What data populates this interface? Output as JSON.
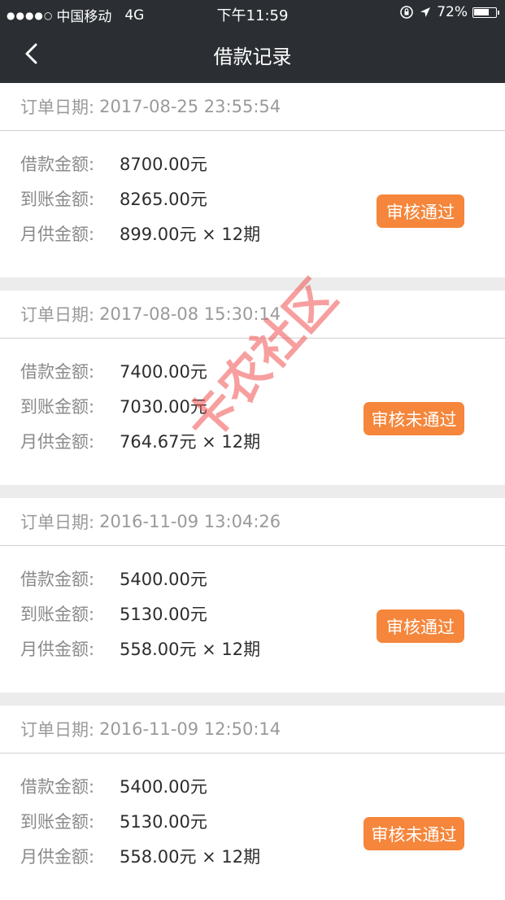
{
  "status_bar": {
    "signal": "●●●●○",
    "carrier": "中国移动",
    "network": "4G",
    "time": "下午11:59",
    "battery": "72%",
    "battery_level": 0.72
  },
  "nav": {
    "title": "借款记录",
    "back_icon": "chevron-left-icon"
  },
  "labels": {
    "order_date": "订单日期:",
    "loan_amount": "借款金额:",
    "received_amount": "到账金额:",
    "monthly_payment": "月供金额:"
  },
  "orders": [
    {
      "date": "2017-08-25 23:55:54",
      "loan": "8700.00元",
      "received": "8265.00元",
      "monthly": "899.00元 × 12期",
      "status": "审核通过"
    },
    {
      "date": "2017-08-08 15:30:14",
      "loan": "7400.00元",
      "received": "7030.00元",
      "monthly": "764.67元 × 12期",
      "status": "审核未通过"
    },
    {
      "date": "2016-11-09 13:04:26",
      "loan": "5400.00元",
      "received": "5130.00元",
      "monthly": "558.00元 × 12期",
      "status": "审核通过"
    },
    {
      "date": "2016-11-09 12:50:14",
      "loan": "5400.00元",
      "received": "5130.00元",
      "monthly": "558.00元 × 12期",
      "status": "审核未通过"
    }
  ],
  "watermark": "卡农社区",
  "colors": {
    "header_bg": "#2b2f33",
    "accent": "#f5863b",
    "page_bg": "#ececec"
  }
}
